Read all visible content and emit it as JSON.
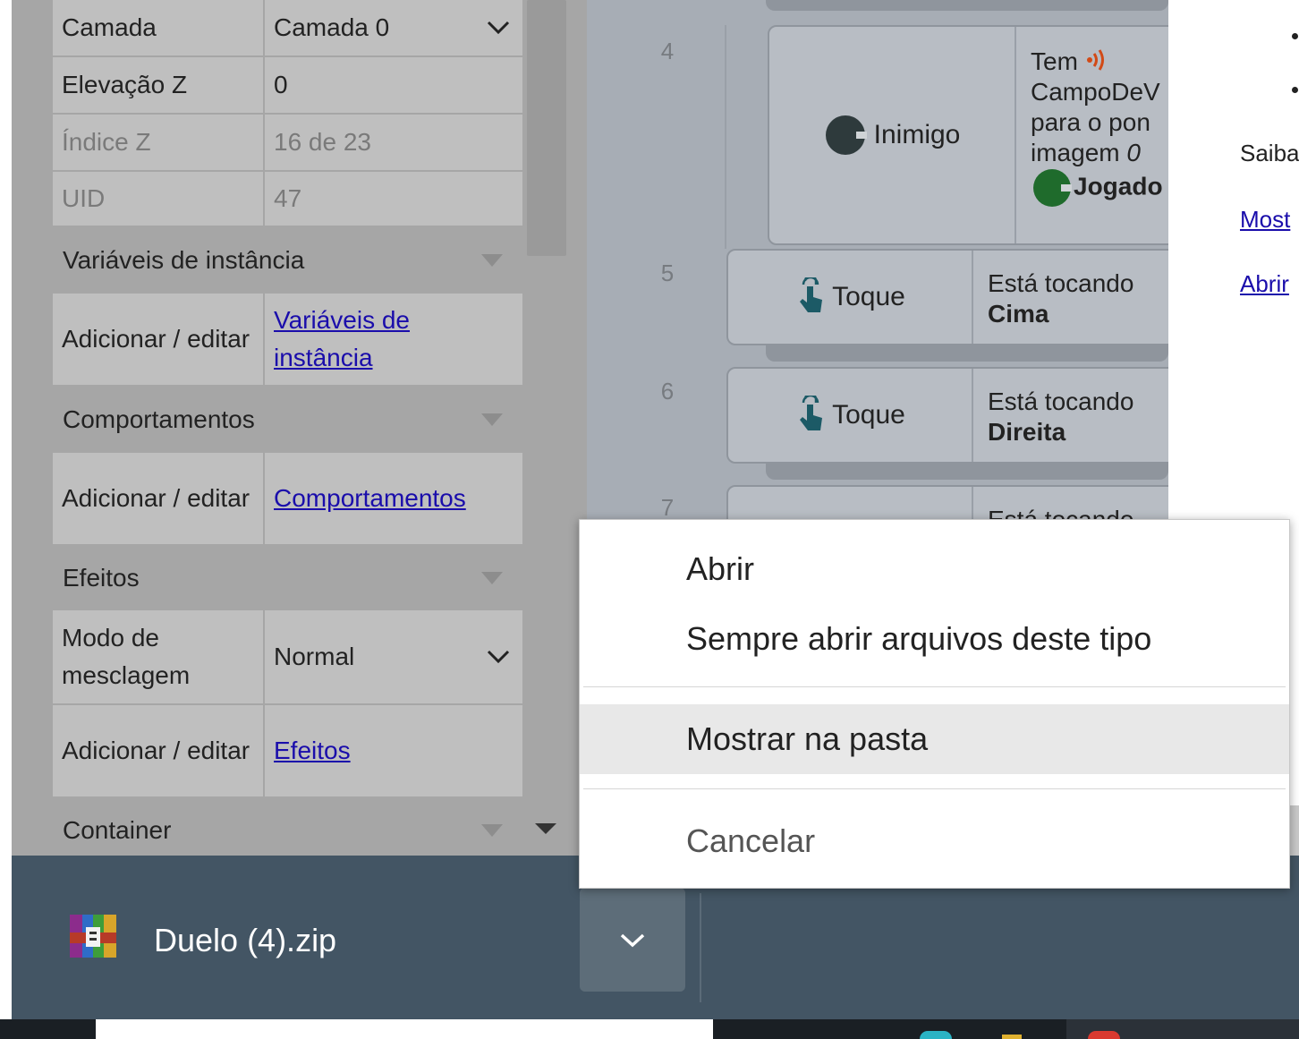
{
  "properties": {
    "rows": [
      {
        "key": "Camada",
        "value": "Camada 0"
      },
      {
        "key": "Elevação Z",
        "value": "0"
      },
      {
        "key": "Índice Z",
        "value": "16 de 23"
      },
      {
        "key": "UID",
        "value": "47"
      }
    ],
    "sections": {
      "instance_vars": "Variáveis de instância",
      "behaviors": "Comportamentos",
      "effects": "Efeitos",
      "container": "Container"
    },
    "add_edit_label": "Adicionar / editar",
    "instance_vars_link": "Variáveis de instância",
    "behaviors_link": "Comportamentos",
    "effects_link": "Efeitos",
    "blend_mode_label": "Modo de mesclagem",
    "blend_mode_value": "Normal"
  },
  "event_sheet": {
    "line_numbers": [
      "4",
      "5",
      "6",
      "7"
    ],
    "event4": {
      "object": "Inimigo",
      "cond_line1": "Tem",
      "cond_line2": "CampoDeV",
      "cond_line3": "para o pon",
      "cond_line4a": "imagem",
      "cond_line4b": "0",
      "cond_obj": "Jogado"
    },
    "event5": {
      "object": "Toque",
      "cond_line1": "Está tocando",
      "cond_line2": "Cima"
    },
    "event6": {
      "object": "Toque",
      "cond_line1": "Está tocando",
      "cond_line2": "Direita"
    },
    "event7": {
      "cond_line1": "Está tocando"
    }
  },
  "right_panel": {
    "saiba": "Saiba",
    "link1": "Most",
    "link2": "Abrir"
  },
  "download_bar": {
    "filename": "Duelo (4).zip",
    "icon": "winrar-archive-icon"
  },
  "context_menu": {
    "items": [
      "Abrir",
      "Sempre abrir arquivos deste tipo",
      "Mostrar na pasta",
      "Cancelar"
    ]
  },
  "colors": {
    "download_bar": "#435564",
    "link": "#1a0dab",
    "menu_hover": "#e8e8e8"
  }
}
